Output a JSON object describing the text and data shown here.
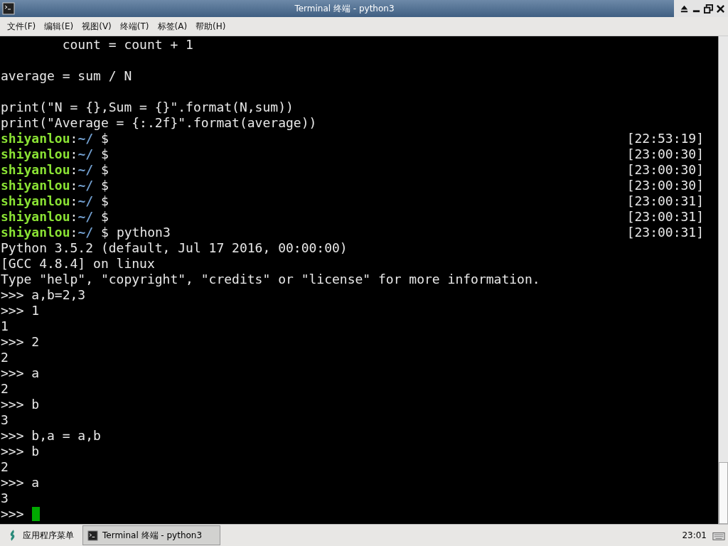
{
  "window": {
    "title": "Terminal 终端 - python3"
  },
  "menu": [
    {
      "label": "文件(F)"
    },
    {
      "label": "编辑(E)"
    },
    {
      "label": "视图(V)"
    },
    {
      "label": "终端(T)"
    },
    {
      "label": "标签(A)"
    },
    {
      "label": "帮助(H)"
    }
  ],
  "terminal": {
    "lines": [
      {
        "kind": "text",
        "text": "        count = count + 1"
      },
      {
        "kind": "blank"
      },
      {
        "kind": "text",
        "text": "average = sum / N"
      },
      {
        "kind": "blank"
      },
      {
        "kind": "text",
        "text": "print(\"N = {},Sum = {}\".format(N,sum))"
      },
      {
        "kind": "text",
        "text": "print(\"Average = {:.2f}\".format(average))"
      },
      {
        "kind": "prompt",
        "user": "shiyanlou",
        "separator": ":",
        "path": "~/",
        "symbol": "$",
        "time": "[22:53:19]"
      },
      {
        "kind": "prompt",
        "user": "shiyanlou",
        "separator": ":",
        "path": "~/",
        "symbol": "$",
        "time": "[23:00:30]"
      },
      {
        "kind": "prompt",
        "user": "shiyanlou",
        "separator": ":",
        "path": "~/",
        "symbol": "$",
        "time": "[23:00:30]"
      },
      {
        "kind": "prompt",
        "user": "shiyanlou",
        "separator": ":",
        "path": "~/",
        "symbol": "$",
        "time": "[23:00:30]"
      },
      {
        "kind": "prompt",
        "user": "shiyanlou",
        "separator": ":",
        "path": "~/",
        "symbol": "$",
        "time": "[23:00:31]"
      },
      {
        "kind": "prompt",
        "user": "shiyanlou",
        "separator": ":",
        "path": "~/",
        "symbol": "$",
        "time": "[23:00:31]"
      },
      {
        "kind": "prompt",
        "user": "shiyanlou",
        "separator": ":",
        "path": "~/",
        "symbol": "$",
        "command": "python3",
        "time": "[23:00:31]"
      },
      {
        "kind": "text",
        "text": "Python 3.5.2 (default, Jul 17 2016, 00:00:00)"
      },
      {
        "kind": "text",
        "text": "[GCC 4.8.4] on linux"
      },
      {
        "kind": "text",
        "text": "Type \"help\", \"copyright\", \"credits\" or \"license\" for more information."
      },
      {
        "kind": "text",
        "text": ">>> a,b=2,3"
      },
      {
        "kind": "text",
        "text": ">>> 1"
      },
      {
        "kind": "text",
        "text": "1"
      },
      {
        "kind": "text",
        "text": ">>> 2"
      },
      {
        "kind": "text",
        "text": "2"
      },
      {
        "kind": "text",
        "text": ">>> a"
      },
      {
        "kind": "text",
        "text": "2"
      },
      {
        "kind": "text",
        "text": ">>> b"
      },
      {
        "kind": "text",
        "text": "3"
      },
      {
        "kind": "text",
        "text": ">>> b,a = a,b"
      },
      {
        "kind": "text",
        "text": ">>> b"
      },
      {
        "kind": "text",
        "text": "2"
      },
      {
        "kind": "text",
        "text": ">>> a"
      },
      {
        "kind": "text",
        "text": "3"
      },
      {
        "kind": "input",
        "text": ">>>",
        "cursor": true
      }
    ]
  },
  "taskbar": {
    "app_menu": "应用程序菜单",
    "tasks": [
      {
        "label": "Terminal 终端 - python3",
        "selected": true
      }
    ],
    "clock": "23:01"
  }
}
